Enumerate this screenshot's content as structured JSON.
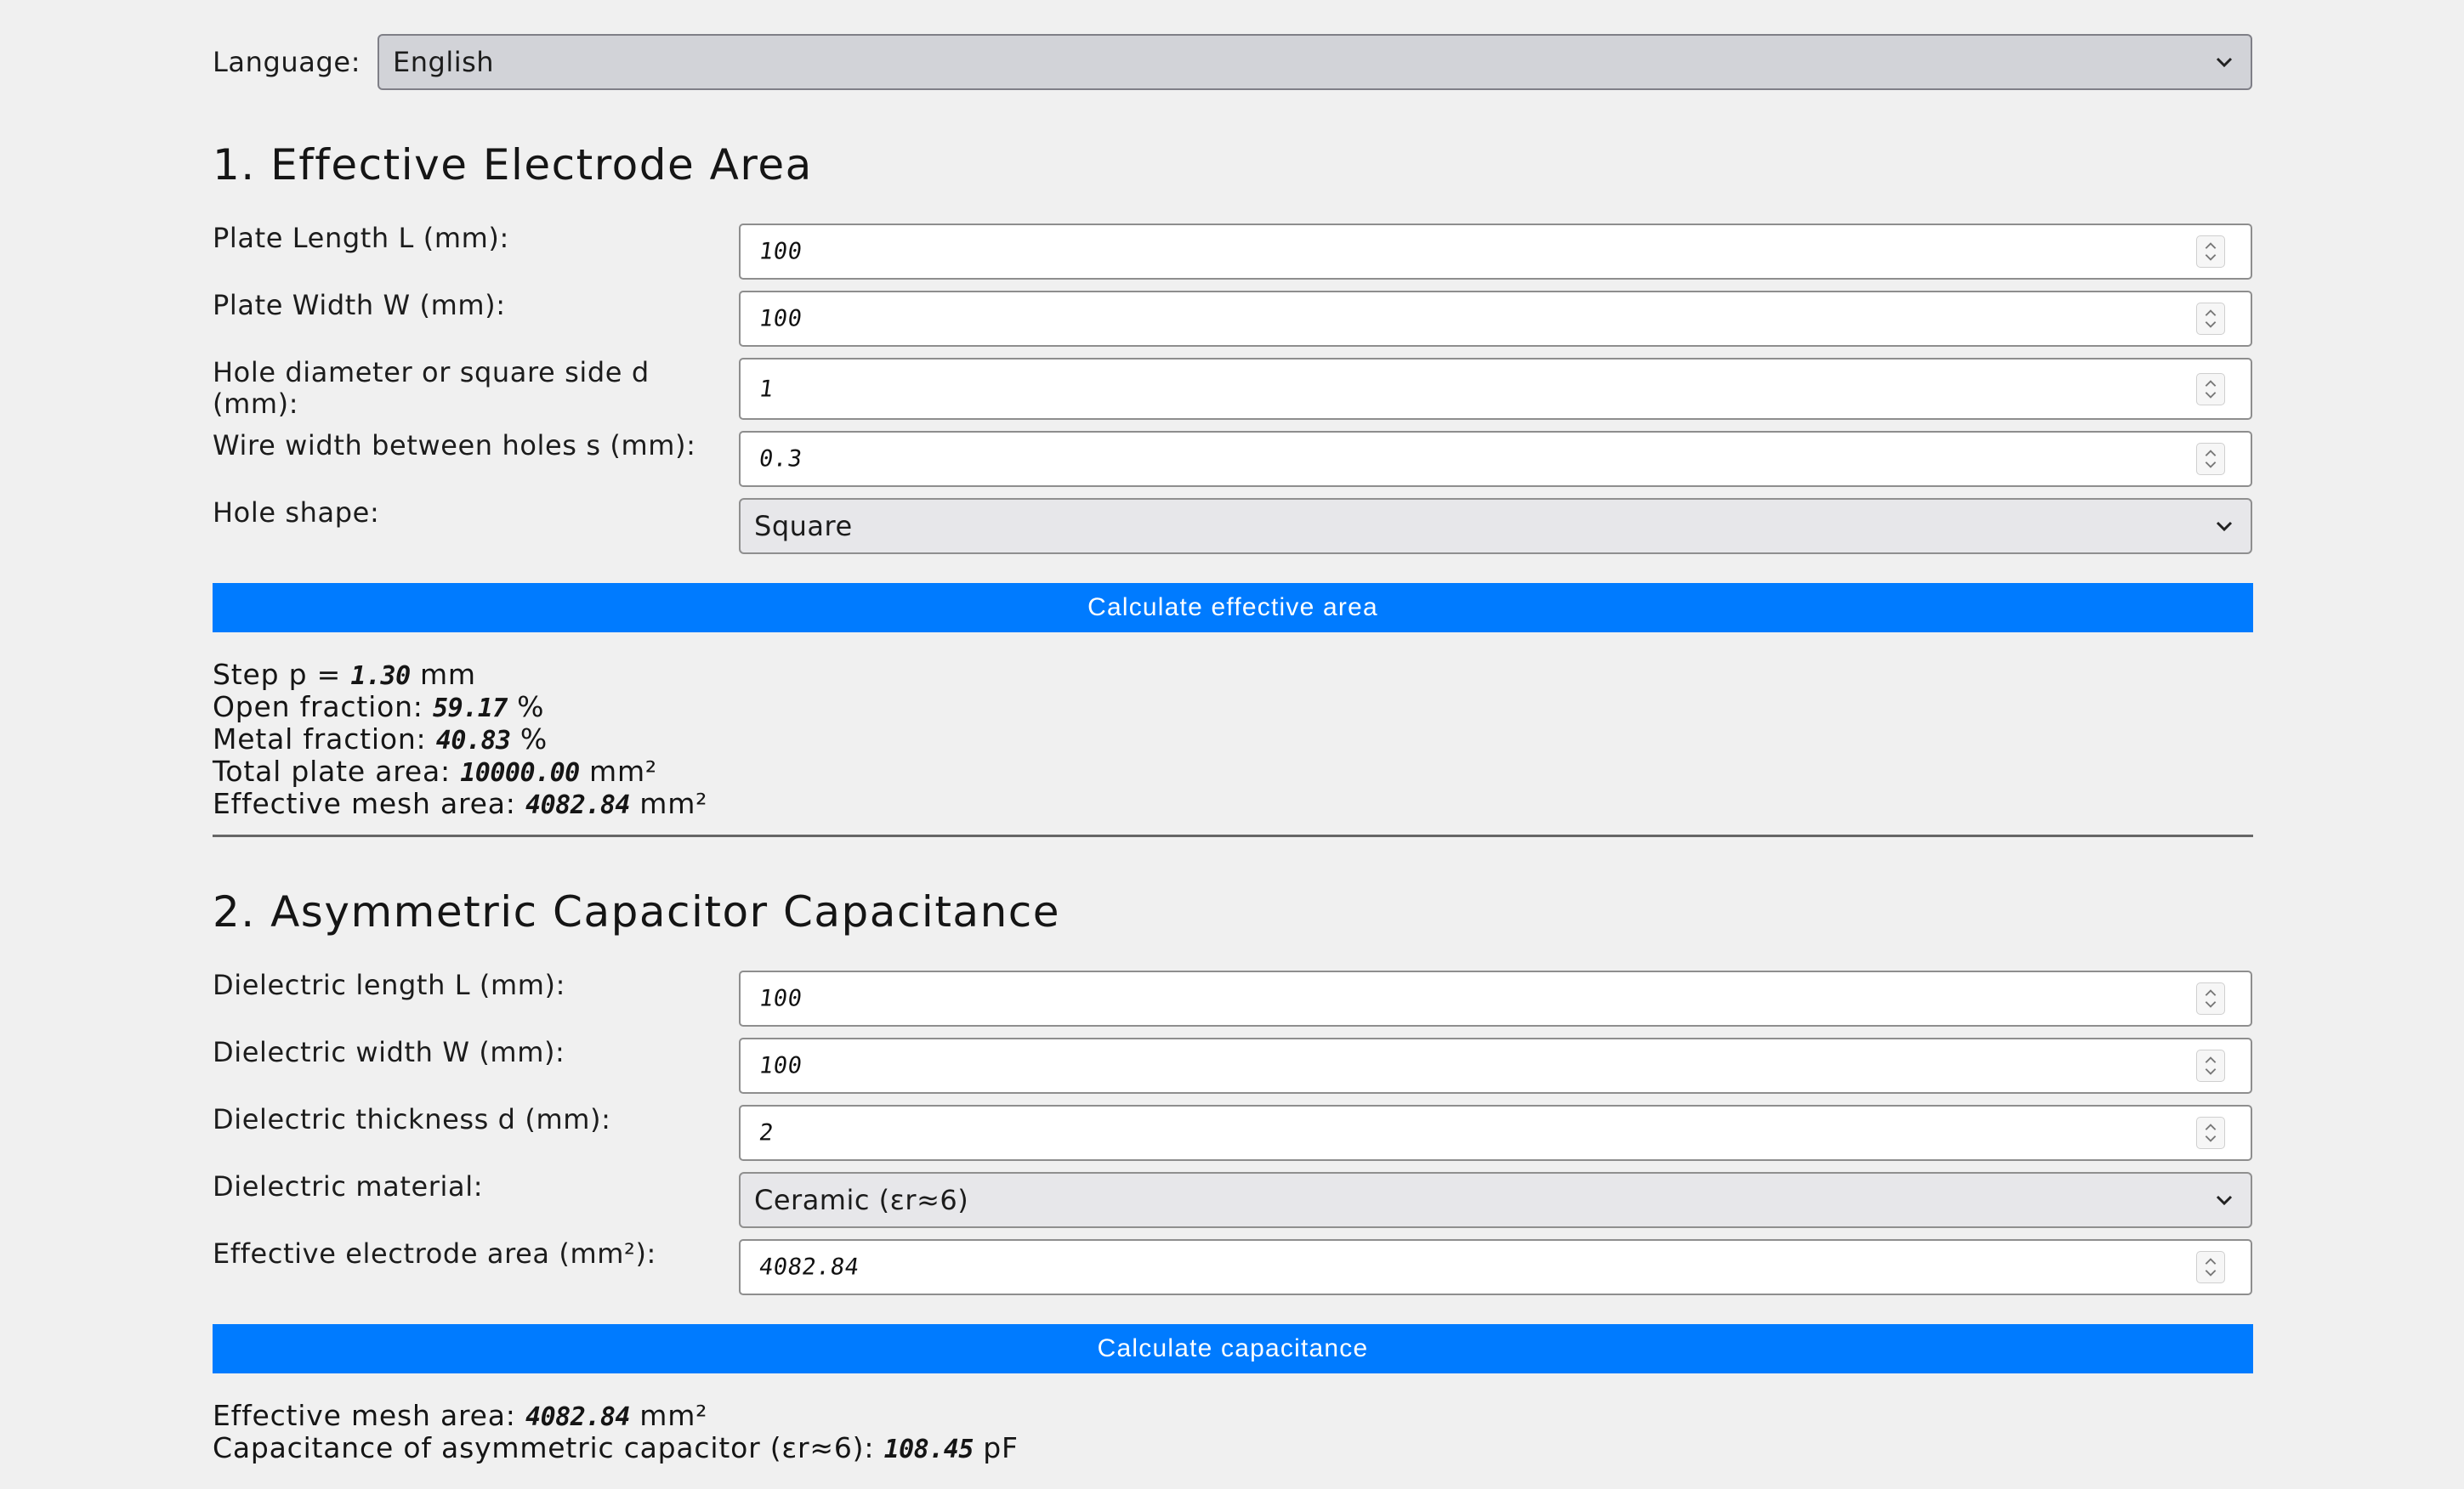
{
  "language": {
    "label": "Language:",
    "selected": "English"
  },
  "section1": {
    "title": "1. Effective Electrode Area",
    "fields": [
      {
        "label": "Plate Length L (mm):",
        "value": "100"
      },
      {
        "label": "Plate Width W (mm):",
        "value": "100"
      },
      {
        "label": "Hole diameter or square side d (mm):",
        "value": "1"
      },
      {
        "label": "Wire width between holes s (mm):",
        "value": "0.3"
      }
    ],
    "hole_shape": {
      "label": "Hole shape:",
      "selected": "Square"
    },
    "button_label": "Calculate effective area",
    "results": {
      "step_label": "Step p =",
      "step_value": "1.30",
      "step_unit": "mm",
      "open_label": "Open fraction:",
      "open_value": "59.17",
      "open_unit": "%",
      "metal_label": "Metal fraction:",
      "metal_value": "40.83",
      "metal_unit": "%",
      "total_label": "Total plate area:",
      "total_value": "10000.00",
      "total_unit": "mm²",
      "mesh_label": "Effective mesh area:",
      "mesh_value": "4082.84",
      "mesh_unit": "mm²"
    }
  },
  "section2": {
    "title": "2. Asymmetric Capacitor Capacitance",
    "fields": [
      {
        "label": "Dielectric length L (mm):",
        "value": "100"
      },
      {
        "label": "Dielectric width W (mm):",
        "value": "100"
      },
      {
        "label": "Dielectric thickness d (mm):",
        "value": "2"
      }
    ],
    "material": {
      "label": "Dielectric material:",
      "selected": "Ceramic (εr≈6)"
    },
    "area_field": {
      "label": "Effective electrode area (mm²):",
      "value": "4082.84"
    },
    "button_label": "Calculate capacitance",
    "results": {
      "mesh_label": "Effective mesh area:",
      "mesh_value": "4082.84",
      "mesh_unit": "mm²",
      "cap_label": "Capacitance of asymmetric capacitor (εr≈6):",
      "cap_value": "108.45",
      "cap_unit": "pF"
    }
  },
  "colors": {
    "accent": "#007bff",
    "background": "#f0f0f0"
  }
}
